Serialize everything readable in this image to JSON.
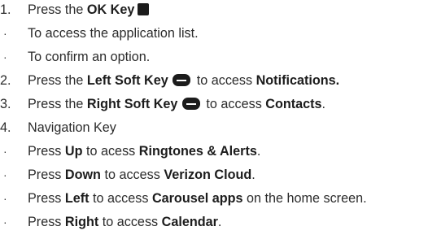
{
  "items": [
    {
      "marker": "1.",
      "segments": [
        "Press the ",
        "OK Key",
        ""
      ]
    },
    {
      "marker": "·",
      "text": "To access the application list."
    },
    {
      "marker": "·",
      "text": "To confirm an option."
    },
    {
      "marker": "2.",
      "segments": [
        "Press the ",
        "Left Soft Key",
        " to access ",
        "Notifications."
      ]
    },
    {
      "marker": "3.",
      "segments": [
        "Press the ",
        "Right Soft Key",
        " to access ",
        "Contacts",
        "."
      ]
    },
    {
      "marker": "4.",
      "text": "Navigation Key"
    },
    {
      "marker": "·",
      "segments": [
        "Press ",
        "Up",
        " to acess ",
        "Ringtones & Alerts",
        "."
      ]
    },
    {
      "marker": "·",
      "segments": [
        "Press ",
        "Down",
        " to access ",
        "Verizon Cloud",
        "."
      ]
    },
    {
      "marker": "·",
      "segments": [
        "Press ",
        "Left",
        " to access ",
        "Carousel apps",
        " on the home screen."
      ]
    },
    {
      "marker": "·",
      "segments": [
        "Press ",
        "Right",
        " to access ",
        "Calendar",
        "."
      ]
    }
  ],
  "icons": {
    "ok_key": "ok-key-icon",
    "left_soft_key": "left-soft-key-icon",
    "right_soft_key": "right-soft-key-icon"
  }
}
